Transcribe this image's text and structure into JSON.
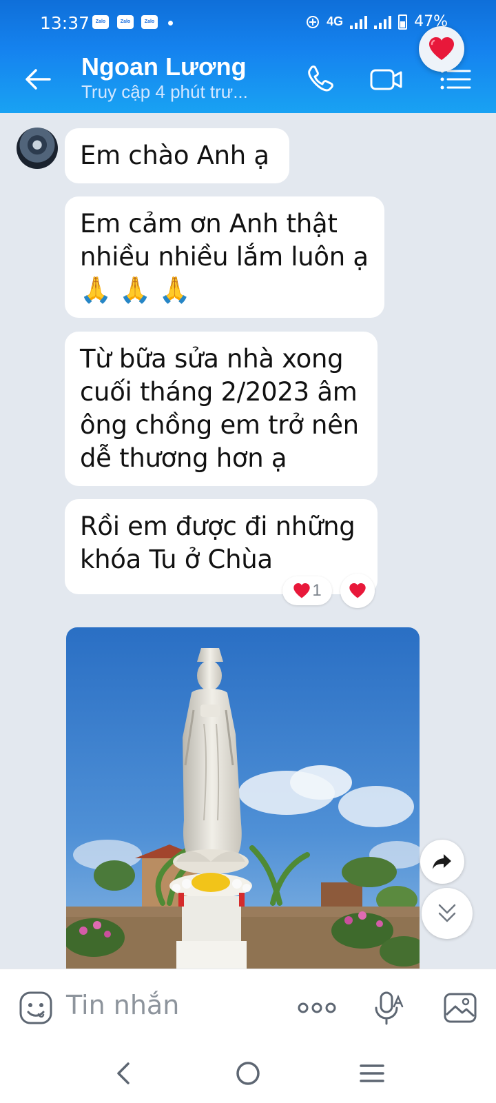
{
  "status_bar": {
    "time": "13:37",
    "notification_badges": [
      "Zalo",
      "Zalo",
      "Zalo"
    ],
    "network": "4G",
    "battery": "47%"
  },
  "header": {
    "contact_name": "Ngoan Lương",
    "last_seen": "Truy cập 4 phút trư..."
  },
  "messages": [
    {
      "text": "Em chào Anh ạ"
    },
    {
      "text": "Em cảm ơn Anh thật\nnhiều nhiều lắm luôn ạ\n🙏 🙏 🙏"
    },
    {
      "text": "Từ bữa sửa nhà xong\ncuối tháng 2/2023 âm\nông chồng em trở nên\ndễ thương hơn ạ"
    },
    {
      "text": "Rồi em được đi những\nkhóa Tu ở Chùa"
    }
  ],
  "reactions": {
    "count": "1"
  },
  "input": {
    "placeholder": "Tin nhắn"
  },
  "colors": {
    "header_blue": "#1583ef",
    "chat_bg": "#e3e8ef",
    "heart_red": "#e8183a"
  },
  "icons": [
    "back-arrow",
    "phone",
    "video-camera",
    "menu-list",
    "heart",
    "share-forward",
    "double-chevron-down",
    "sticker",
    "more-dots",
    "voice-mic",
    "image-gallery"
  ]
}
